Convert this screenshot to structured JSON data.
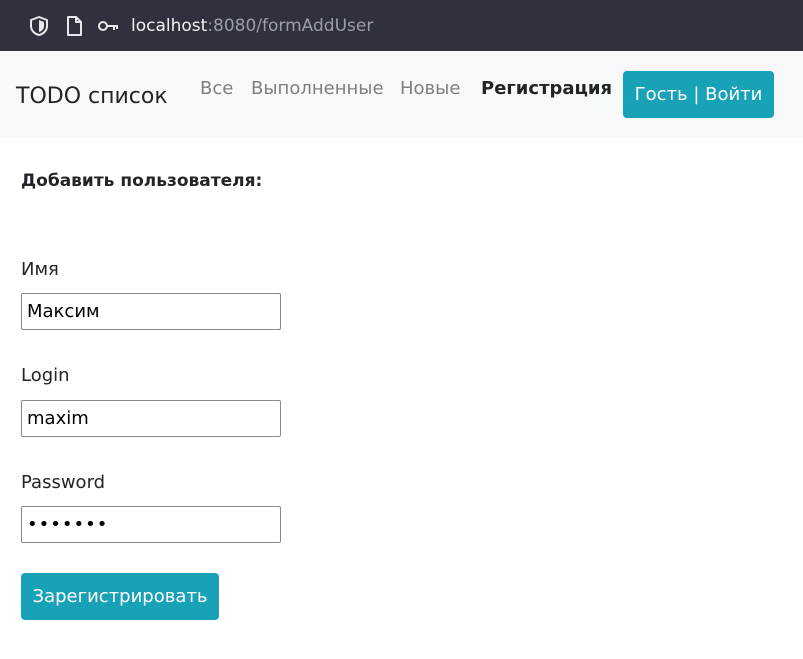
{
  "browser": {
    "url_host": "localhost",
    "url_rest": ":8080/formAddUser",
    "icons": [
      "shield-icon",
      "page-icon",
      "key-icon"
    ]
  },
  "navbar": {
    "brand": "TODO список",
    "links": {
      "all": "Все",
      "done": "Выполненные",
      "new": "Новые",
      "register": "Регистрация"
    },
    "login_button": "Гость | Войти"
  },
  "form": {
    "title": "Добавить пользователя:",
    "name_label": "Имя",
    "name_value": "Максим",
    "login_label": "Login",
    "login_value": "maxim",
    "password_label": "Password",
    "password_value": "•••••••",
    "submit_label": "Зарегистрировать"
  },
  "colors": {
    "accent": "#17a2b8",
    "navbar_bg": "#f8f9fa",
    "urlbar_bg": "#2f323c"
  }
}
